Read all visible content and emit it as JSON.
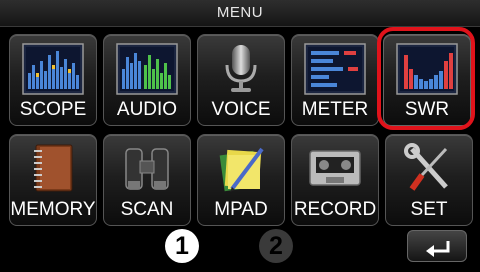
{
  "title": "MENU",
  "tiles": [
    {
      "label": "SCOPE",
      "icon": "scope-icon"
    },
    {
      "label": "AUDIO",
      "icon": "audio-icon"
    },
    {
      "label": "VOICE",
      "icon": "microphone-icon"
    },
    {
      "label": "METER",
      "icon": "meter-icon"
    },
    {
      "label": "SWR",
      "icon": "swr-graph-icon"
    },
    {
      "label": "MEMORY",
      "icon": "memory-book-icon"
    },
    {
      "label": "SCAN",
      "icon": "binoculars-icon"
    },
    {
      "label": "MPAD",
      "icon": "memo-pad-icon"
    },
    {
      "label": "RECORD",
      "icon": "cassette-icon"
    },
    {
      "label": "SET",
      "icon": "tools-icon"
    }
  ],
  "pages": [
    "1",
    "2"
  ],
  "current_page": "1",
  "selected_tile": "SWR",
  "colors": {
    "highlight": "#e0131b",
    "background": "#000000"
  },
  "back_button": {
    "icon": "return-arrow-icon"
  }
}
